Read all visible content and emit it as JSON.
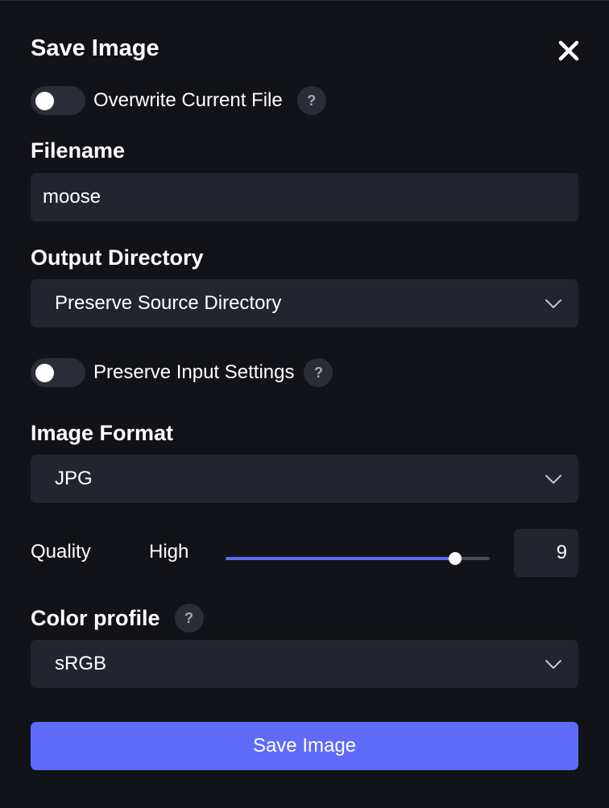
{
  "dialog": {
    "title": "Save Image"
  },
  "overwrite": {
    "label": "Overwrite Current File",
    "enabled": false
  },
  "filename": {
    "label": "Filename",
    "value": "moose"
  },
  "output_directory": {
    "label": "Output Directory",
    "selected": "Preserve Source Directory"
  },
  "preserve_input": {
    "label": "Preserve Input Settings",
    "enabled": false
  },
  "image_format": {
    "label": "Image Format",
    "selected": "JPG"
  },
  "quality": {
    "label": "Quality",
    "level_text": "High",
    "value": "9",
    "fraction": 0.87
  },
  "color_profile": {
    "label": "Color profile",
    "selected": "sRGB"
  },
  "help_glyph": "?",
  "save_button": {
    "label": "Save Image"
  },
  "colors": {
    "background": "#121318",
    "field": "#22252e",
    "accent": "#5f6bf8"
  }
}
